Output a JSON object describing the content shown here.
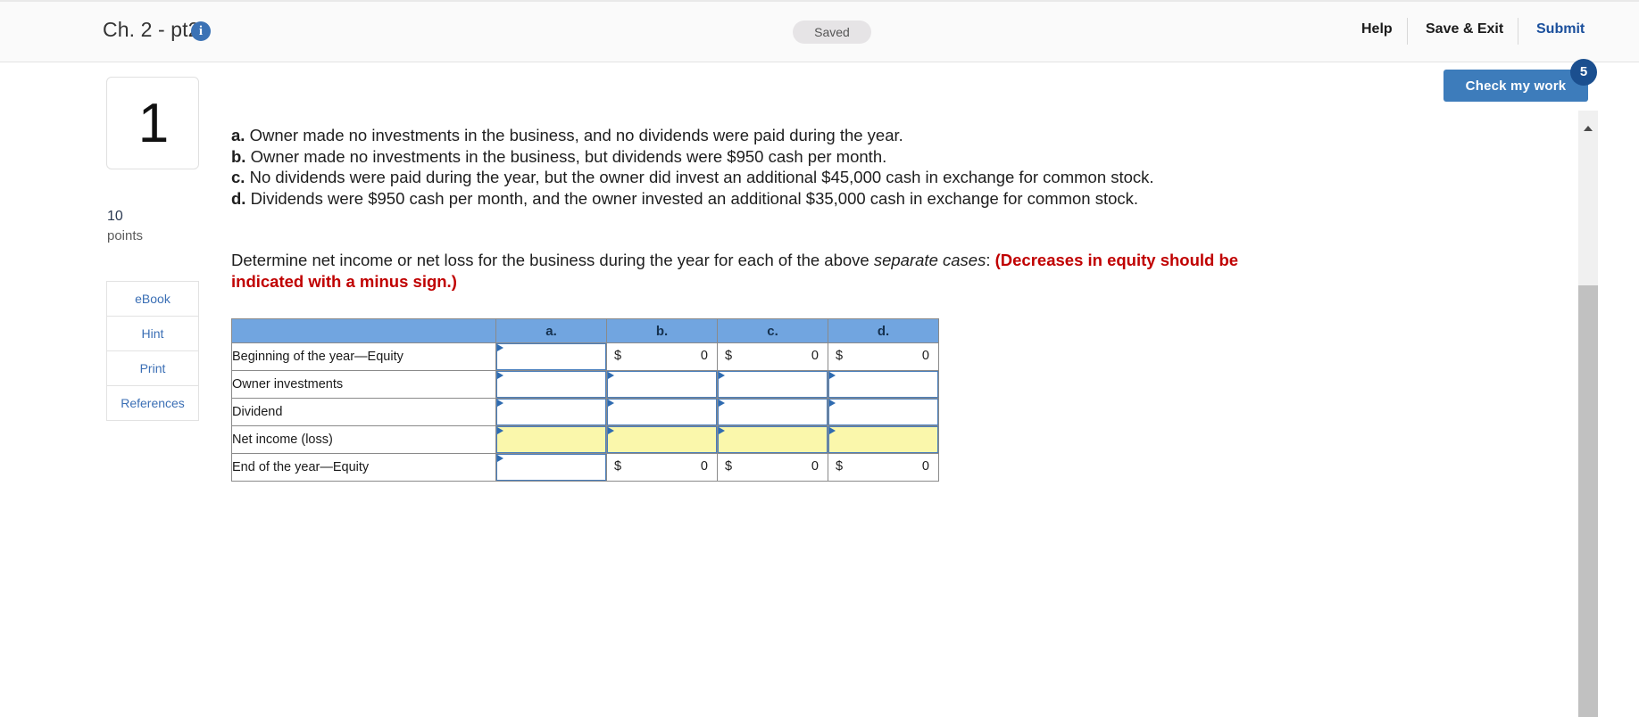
{
  "header": {
    "title": "Ch. 2 - pt2",
    "info_icon": "info-icon",
    "status_pill": "Saved",
    "help_label": "Help",
    "save_exit_label": "Save & Exit",
    "submit_label": "Submit"
  },
  "check_work": {
    "label": "Check my work",
    "badge_count": "5",
    "accent_color": "#3d7cbb",
    "badge_color": "#1b4f8f"
  },
  "question_rail": {
    "number": "1",
    "points_value": "10",
    "points_label": "points",
    "resources": [
      {
        "label": "eBook"
      },
      {
        "label": "Hint"
      },
      {
        "label": "Print"
      },
      {
        "label": "References"
      }
    ]
  },
  "question": {
    "cases": [
      {
        "letter": "a.",
        "text": "Owner made no investments in the business, and no dividends were paid during the year."
      },
      {
        "letter": "b.",
        "text": "Owner made no investments in the business, but dividends were $950 cash per month."
      },
      {
        "letter": "c.",
        "text": "No dividends were paid during the year, but the owner did invest an additional $45,000 cash in exchange for common stock."
      },
      {
        "letter": "d.",
        "text": "Dividends were $950 cash per month, and the owner invested an additional $35,000 cash in exchange for common stock."
      }
    ],
    "requirement_lead": "Determine net income or net loss for the business during the year for each of the above ",
    "requirement_italic": "separate cases",
    "requirement_colon": ": ",
    "requirement_red": "(Decreases in equity should be indicated with a minus sign.)"
  },
  "worksheet": {
    "header_color": "#71a5e0",
    "input_border_color": "#4a7ebb",
    "highlight_color": "#faf7ab",
    "columns": [
      "",
      "a.",
      "b.",
      "c.",
      "d."
    ],
    "rows": [
      {
        "label": "Beginning of the year—Equity",
        "cells": [
          {
            "type": "input",
            "value": "",
            "highlight": false
          },
          {
            "type": "static",
            "currency": "$",
            "value": "0"
          },
          {
            "type": "static",
            "currency": "$",
            "value": "0"
          },
          {
            "type": "static",
            "currency": "$",
            "value": "0"
          }
        ]
      },
      {
        "label": "Owner investments",
        "cells": [
          {
            "type": "input",
            "value": "",
            "highlight": false
          },
          {
            "type": "input",
            "value": "",
            "highlight": false
          },
          {
            "type": "input",
            "value": "",
            "highlight": false
          },
          {
            "type": "input",
            "value": "",
            "highlight": false
          }
        ]
      },
      {
        "label": "Dividend",
        "cells": [
          {
            "type": "input",
            "value": "",
            "highlight": false
          },
          {
            "type": "input",
            "value": "",
            "highlight": false
          },
          {
            "type": "input",
            "value": "",
            "highlight": false
          },
          {
            "type": "input",
            "value": "",
            "highlight": false
          }
        ]
      },
      {
        "label": "Net income (loss)",
        "cells": [
          {
            "type": "input",
            "value": "",
            "highlight": true
          },
          {
            "type": "input",
            "value": "",
            "highlight": true
          },
          {
            "type": "input",
            "value": "",
            "highlight": true
          },
          {
            "type": "input",
            "value": "",
            "highlight": true
          }
        ]
      },
      {
        "label": "End of the year—Equity",
        "cells": [
          {
            "type": "input",
            "value": "",
            "highlight": false
          },
          {
            "type": "static",
            "currency": "$",
            "value": "0"
          },
          {
            "type": "static",
            "currency": "$",
            "value": "0"
          },
          {
            "type": "static",
            "currency": "$",
            "value": "0"
          }
        ]
      }
    ]
  }
}
